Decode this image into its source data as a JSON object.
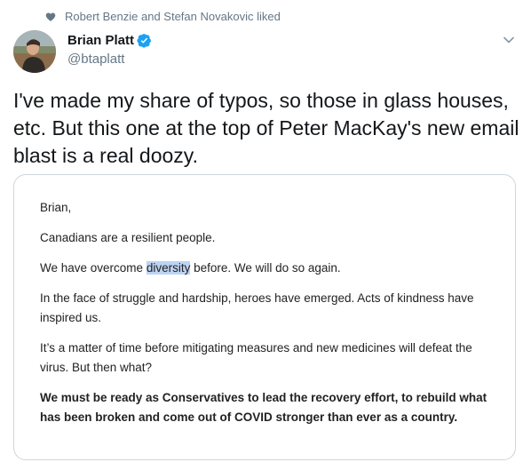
{
  "social_context": {
    "text": "Robert Benzie and Stefan Novakovic liked",
    "icon": "heart-icon"
  },
  "author": {
    "display_name": "Brian Platt",
    "handle": "@btaplatt",
    "verified": true
  },
  "tweet": {
    "text": "I've made my share of typos, so those in glass houses, etc. But this one at the top of Peter MacKay's new email blast is a real doozy."
  },
  "email": {
    "greeting": "Brian,",
    "line1": "Canadians are a resilient people.",
    "line2_before": "We have overcome ",
    "line2_highlight": "diversity",
    "line2_after": " before. We will do so again.",
    "line3": "In the face of struggle and hardship, heroes have emerged.  Acts of kindness have inspired us.",
    "line4": "It’s a matter of time before mitigating measures and new medicines will defeat the virus.  But then what?",
    "line5_bold": "We must be ready as Conservatives to lead the recovery effort, to rebuild what has been broken and come out of COVID stronger than ever as a country."
  },
  "colors": {
    "secondary_text": "#657786",
    "verified_blue": "#1da1f2",
    "highlight": "#bcd3f3"
  }
}
